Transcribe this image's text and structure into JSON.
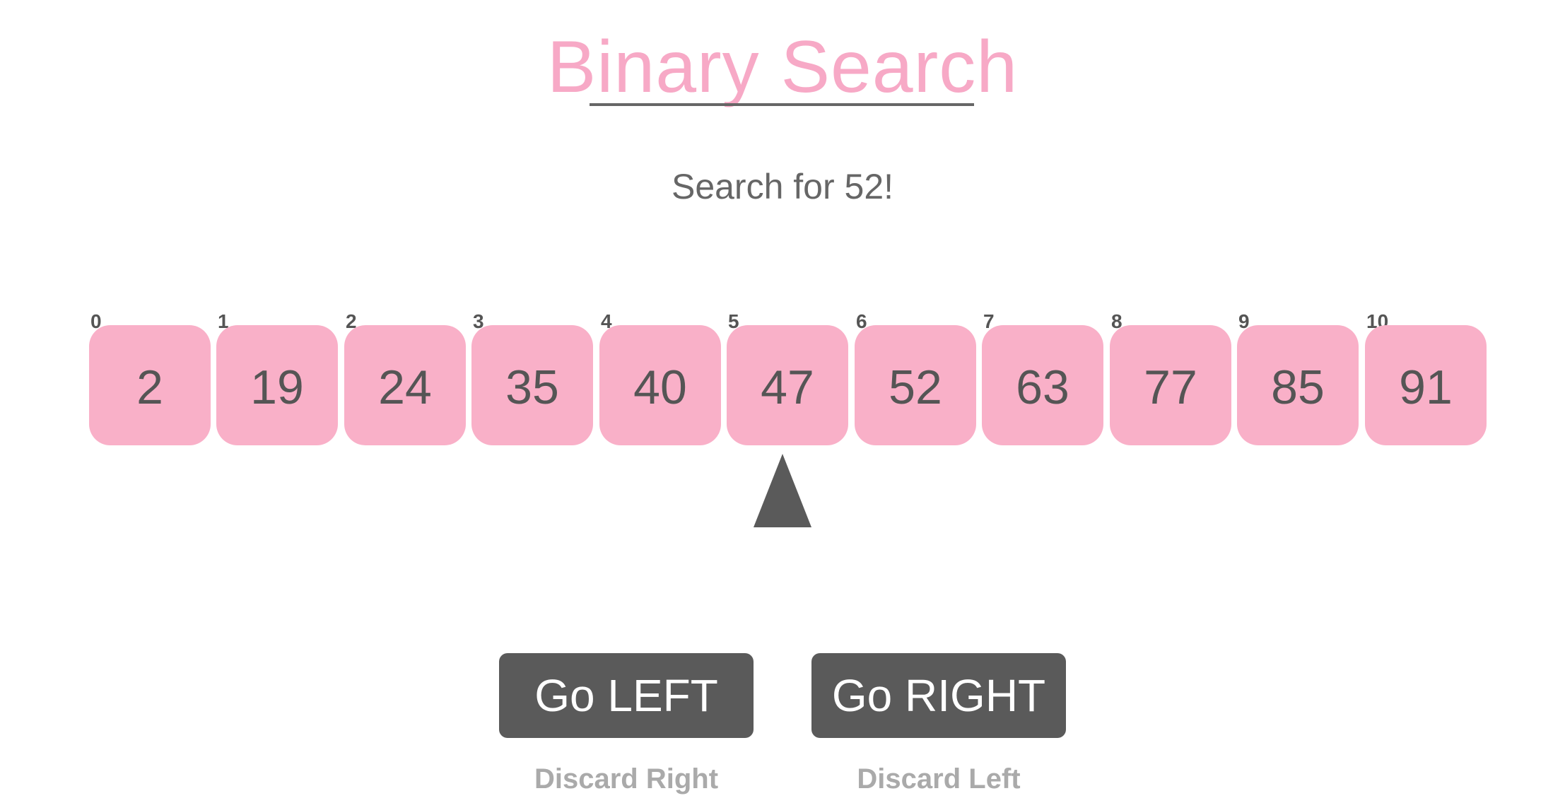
{
  "header": {
    "title": "Binary Search"
  },
  "prompt": {
    "text": "Search for 52!"
  },
  "array": {
    "cells": [
      {
        "index": "0",
        "value": "2"
      },
      {
        "index": "1",
        "value": "19"
      },
      {
        "index": "2",
        "value": "24"
      },
      {
        "index": "3",
        "value": "35"
      },
      {
        "index": "4",
        "value": "40"
      },
      {
        "index": "5",
        "value": "47"
      },
      {
        "index": "6",
        "value": "52"
      },
      {
        "index": "7",
        "value": "63"
      },
      {
        "index": "8",
        "value": "77"
      },
      {
        "index": "9",
        "value": "85"
      },
      {
        "index": "10",
        "value": "91"
      }
    ],
    "pointer_index": 5
  },
  "controls": {
    "go_left_label": "Go LEFT",
    "go_right_label": "Go RIGHT",
    "go_left_hint": "Discard Right",
    "go_right_hint": "Discard Left"
  },
  "colors": {
    "accent_pink": "#f7a9c6",
    "cell_pink": "#f9b0c8",
    "dark_gray": "#5a5a5a",
    "text_gray": "#666666",
    "hint_gray": "#aaaaaa"
  },
  "icons": {
    "pointer": "triangle-up-icon"
  }
}
